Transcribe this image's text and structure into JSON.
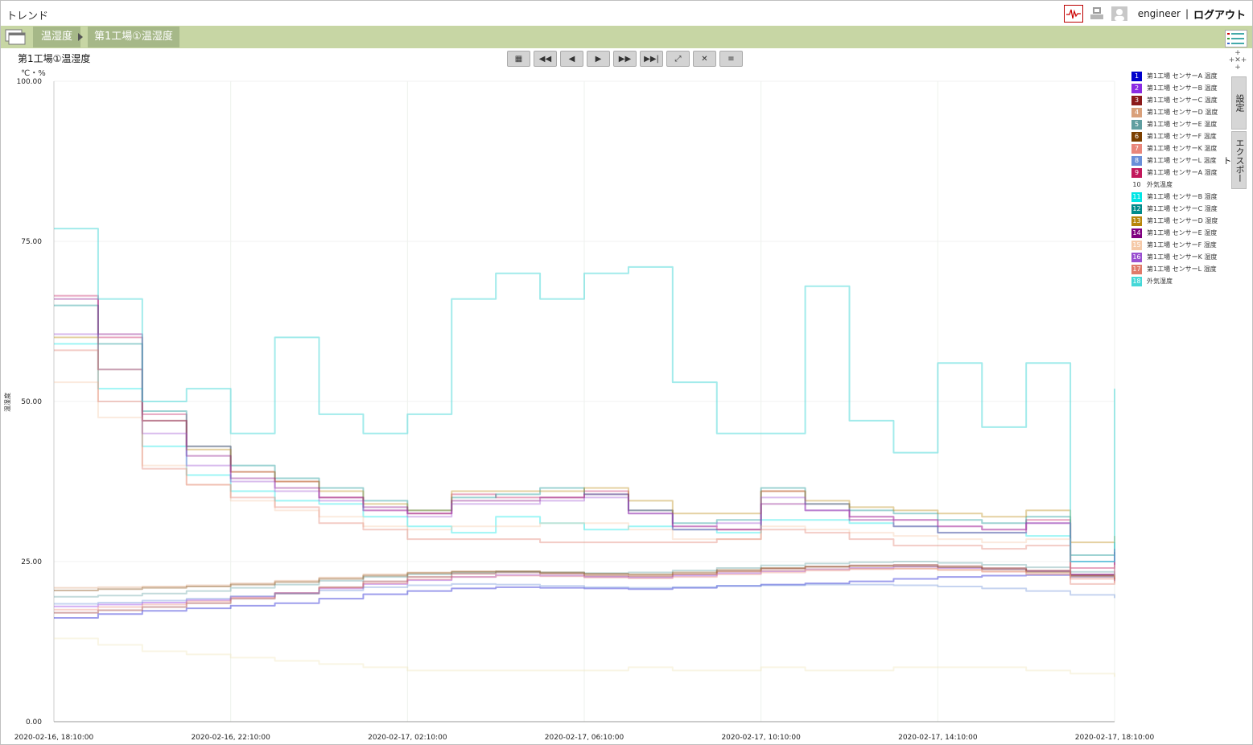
{
  "app": {
    "title": "トレンド",
    "user": "engineer",
    "sep": "|",
    "logout": "ログアウト"
  },
  "breadcrumb": {
    "level1": "温湿度",
    "level2": "第1工場①温湿度"
  },
  "chart_header": {
    "title": "第1工場①温湿度",
    "unit": "℃・%"
  },
  "toolbar": [
    "calendar-icon",
    "rewind-icon",
    "step-back-icon",
    "play-icon",
    "fast-forward-icon",
    "skip-end-icon",
    "expand-icon",
    "shrink-icon",
    "menu-icon"
  ],
  "side_tabs": {
    "settings": "設定",
    "export": "エクスポート"
  },
  "chart_data": {
    "type": "line",
    "ylabel": "温湿度",
    "ylim": [
      0,
      100
    ],
    "yticks": [
      "0.00",
      "25.00",
      "50.00",
      "75.00",
      "100.00"
    ],
    "xticks": [
      "2020-02-16, 18:10:00",
      "2020-02-16, 22:10:00",
      "2020-02-17, 02:10:00",
      "2020-02-17, 06:10:00",
      "2020-02-17, 10:10:00",
      "2020-02-17, 14:10:00",
      "2020-02-17, 18:10:00"
    ],
    "x_hours": [
      0,
      1,
      2,
      3,
      4,
      5,
      6,
      7,
      8,
      9,
      10,
      11,
      12,
      13,
      14,
      15,
      16,
      17,
      18,
      19,
      20,
      21,
      22,
      23,
      24
    ],
    "legend_position": "right",
    "series": [
      {
        "name": "第1工場 センサーA 温度",
        "color": "#0000cc",
        "values": [
          16.2,
          16.8,
          17.3,
          17.7,
          18.1,
          18.5,
          19.2,
          19.9,
          20.4,
          20.8,
          21.0,
          20.9,
          20.8,
          20.7,
          20.9,
          21.2,
          21.4,
          21.6,
          21.9,
          22.3,
          22.6,
          22.8,
          22.9,
          22.6,
          22.0
        ]
      },
      {
        "name": "第1工場 センサーB 温度",
        "color": "#8a2be2",
        "values": [
          18.0,
          18.3,
          18.6,
          19.0,
          19.5,
          20.1,
          20.8,
          21.5,
          22.1,
          22.6,
          22.9,
          22.8,
          22.6,
          22.5,
          22.8,
          23.2,
          23.5,
          23.8,
          24.0,
          24.2,
          24.0,
          23.8,
          23.5,
          22.9,
          22.4
        ]
      },
      {
        "name": "第1工場 センサーC 温度",
        "color": "#8b1a1a",
        "values": [
          17.0,
          17.4,
          17.9,
          18.5,
          19.2,
          20.0,
          21.0,
          21.9,
          22.6,
          23.1,
          23.3,
          23.1,
          22.8,
          22.7,
          23.0,
          23.5,
          23.9,
          24.2,
          24.4,
          24.5,
          24.3,
          24.0,
          23.6,
          22.9,
          22.2
        ]
      },
      {
        "name": "第1工場 センサーD 温度",
        "color": "#d9a07a",
        "values": [
          20.9,
          21.0,
          21.1,
          21.3,
          21.6,
          22.0,
          22.5,
          23.0,
          23.3,
          23.5,
          23.4,
          23.2,
          23.0,
          22.9,
          23.1,
          23.4,
          23.6,
          23.8,
          23.9,
          23.9,
          23.7,
          23.5,
          23.2,
          22.7,
          22.3
        ]
      },
      {
        "name": "第1工場 センサーE 温度",
        "color": "#5f9ea0",
        "values": [
          19.5,
          19.7,
          20.0,
          20.4,
          20.9,
          21.4,
          22.0,
          22.6,
          23.0,
          23.3,
          23.4,
          23.3,
          23.2,
          23.3,
          23.6,
          24.0,
          24.4,
          24.7,
          24.9,
          25.0,
          24.8,
          24.5,
          24.1,
          23.4,
          22.8
        ]
      },
      {
        "name": "第1工場 センサーF 温度",
        "color": "#7b3f00",
        "values": [
          20.5,
          20.7,
          20.9,
          21.1,
          21.4,
          21.8,
          22.3,
          22.8,
          23.2,
          23.4,
          23.5,
          23.3,
          23.1,
          23.0,
          23.3,
          23.7,
          24.0,
          24.2,
          24.3,
          24.3,
          24.1,
          23.8,
          23.4,
          22.8,
          22.3
        ]
      },
      {
        "name": "第1工場 センサーK 温度",
        "color": "#e9867a",
        "values": [
          17.5,
          17.9,
          18.3,
          18.8,
          19.4,
          20.1,
          20.9,
          21.6,
          22.2,
          22.6,
          22.8,
          22.7,
          22.5,
          22.4,
          22.6,
          23.0,
          23.3,
          23.6,
          23.8,
          23.9,
          23.7,
          23.4,
          23.0,
          22.3,
          21.7
        ]
      },
      {
        "name": "第1工場 センサーL 温度",
        "color": "#6a8fd8",
        "values": [
          18.4,
          18.6,
          18.9,
          19.2,
          19.6,
          20.0,
          20.5,
          21.0,
          21.3,
          21.5,
          21.4,
          21.2,
          21.0,
          20.9,
          21.0,
          21.2,
          21.3,
          21.4,
          21.4,
          21.3,
          21.1,
          20.8,
          20.4,
          19.8,
          19.3
        ]
      },
      {
        "name": "第1工場 センサーA 湿度",
        "color": "#c2185b",
        "values": [
          66.5,
          60.0,
          48.0,
          43.0,
          39.0,
          37.5,
          35.0,
          33.0,
          32.5,
          35.5,
          35.0,
          35.0,
          36.0,
          33.0,
          30.5,
          30.0,
          36.0,
          34.0,
          32.0,
          31.5,
          30.5,
          30.0,
          31.5,
          24.0,
          27.0
        ]
      },
      {
        "name": "外気温度",
        "color": "#f0e4b8",
        "values": [
          13.0,
          12.0,
          11.0,
          10.5,
          10.0,
          9.5,
          9.0,
          8.5,
          8.0,
          8.0,
          8.0,
          8.0,
          8.0,
          8.5,
          8.0,
          8.0,
          8.5,
          8.0,
          8.0,
          8.5,
          8.5,
          8.5,
          8.0,
          7.5,
          7.0
        ]
      },
      {
        "name": "第1工場 センサーB 湿度",
        "color": "#00e5e5",
        "values": [
          59.0,
          52.0,
          43.0,
          38.5,
          36.0,
          34.5,
          34.0,
          32.0,
          30.5,
          29.5,
          32.0,
          31.0,
          30.0,
          30.5,
          30.0,
          29.5,
          31.5,
          31.5,
          31.0,
          30.5,
          29.5,
          29.5,
          29.0,
          25.0,
          26.0
        ]
      },
      {
        "name": "第1工場 センサーC 湿度",
        "color": "#008b8b",
        "values": [
          65.0,
          59.0,
          48.5,
          43.0,
          40.0,
          38.0,
          36.5,
          34.5,
          33.0,
          35.0,
          35.5,
          36.5,
          35.5,
          33.0,
          31.0,
          31.5,
          36.5,
          34.0,
          33.0,
          32.5,
          31.5,
          31.0,
          32.0,
          26.0,
          28.0
        ]
      },
      {
        "name": "第1工場 センサーD 湿度",
        "color": "#b8860b",
        "values": [
          60.0,
          55.0,
          47.0,
          42.5,
          39.0,
          37.5,
          36.0,
          34.0,
          33.0,
          36.0,
          36.0,
          36.0,
          36.5,
          34.5,
          32.5,
          32.5,
          36.0,
          34.5,
          33.5,
          33.0,
          32.5,
          32.0,
          33.0,
          28.0,
          29.0
        ]
      },
      {
        "name": "第1工場 センサーE 湿度",
        "color": "#800080",
        "values": [
          66.0,
          60.5,
          47.0,
          41.5,
          38.0,
          36.5,
          35.0,
          33.5,
          32.5,
          34.5,
          34.5,
          35.0,
          35.5,
          32.5,
          30.0,
          30.0,
          34.0,
          33.0,
          31.5,
          30.5,
          29.5,
          29.5,
          31.0,
          23.0,
          26.5
        ]
      },
      {
        "name": "第1工場 センサーF 湿度",
        "color": "#f5c9a8",
        "values": [
          53.0,
          47.5,
          40.0,
          37.0,
          34.5,
          33.0,
          32.0,
          30.5,
          30.0,
          30.5,
          30.5,
          31.0,
          31.0,
          30.0,
          28.5,
          28.5,
          30.5,
          30.0,
          29.5,
          29.0,
          28.5,
          28.0,
          28.5,
          22.5,
          24.5
        ]
      },
      {
        "name": "第1工場 センサーK 湿度",
        "color": "#9a4fd0",
        "values": [
          60.5,
          55.0,
          45.0,
          40.0,
          37.5,
          36.0,
          34.5,
          33.0,
          32.0,
          34.0,
          34.0,
          34.5,
          35.0,
          32.5,
          30.5,
          31.0,
          35.0,
          33.0,
          32.0,
          31.5,
          30.5,
          30.0,
          31.0,
          25.0,
          27.0
        ]
      },
      {
        "name": "第1工場 センサーL 湿度",
        "color": "#e07a6a",
        "values": [
          58.0,
          50.0,
          39.5,
          37.0,
          35.0,
          33.5,
          31.0,
          30.0,
          28.5,
          28.5,
          28.5,
          28.0,
          28.0,
          28.0,
          28.0,
          28.5,
          30.0,
          29.5,
          28.5,
          27.5,
          27.5,
          27.0,
          27.5,
          21.5,
          22.5
        ]
      },
      {
        "name": "外気湿度",
        "color": "#45d8d8",
        "values": [
          77.0,
          66.0,
          50.0,
          52.0,
          45.0,
          60.0,
          48.0,
          45.0,
          48.0,
          66.0,
          70.0,
          66.0,
          70.0,
          71.0,
          53.0,
          45.0,
          45.0,
          68.0,
          47.0,
          42.0,
          56.0,
          46.0,
          56.0,
          25.0,
          52.0
        ]
      }
    ]
  }
}
